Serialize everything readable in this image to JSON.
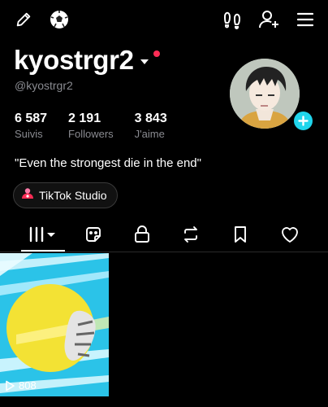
{
  "profile": {
    "username": "kyostrgr2",
    "handle": "@kyostrgr2",
    "bio": "\"Even the strongest die in the end\""
  },
  "stats": [
    {
      "value": "6 587",
      "label": "Suivis"
    },
    {
      "value": "2 191",
      "label": "Followers"
    },
    {
      "value": "3 843",
      "label": "J'aime"
    }
  ],
  "studio_button": {
    "label": "TikTok Studio"
  },
  "tabs": [
    {
      "icon": "grid-icon",
      "active": true
    },
    {
      "icon": "sticker-icon"
    },
    {
      "icon": "lock-icon"
    },
    {
      "icon": "repost-icon"
    },
    {
      "icon": "bookmark-icon"
    },
    {
      "icon": "heart-icon"
    }
  ],
  "videos": [
    {
      "views": "808"
    }
  ],
  "colors": {
    "background": "#000000",
    "accent_cyan": "#20d5ec",
    "notification_red": "#fe2c55",
    "secondary_text": "#8a8b91"
  }
}
